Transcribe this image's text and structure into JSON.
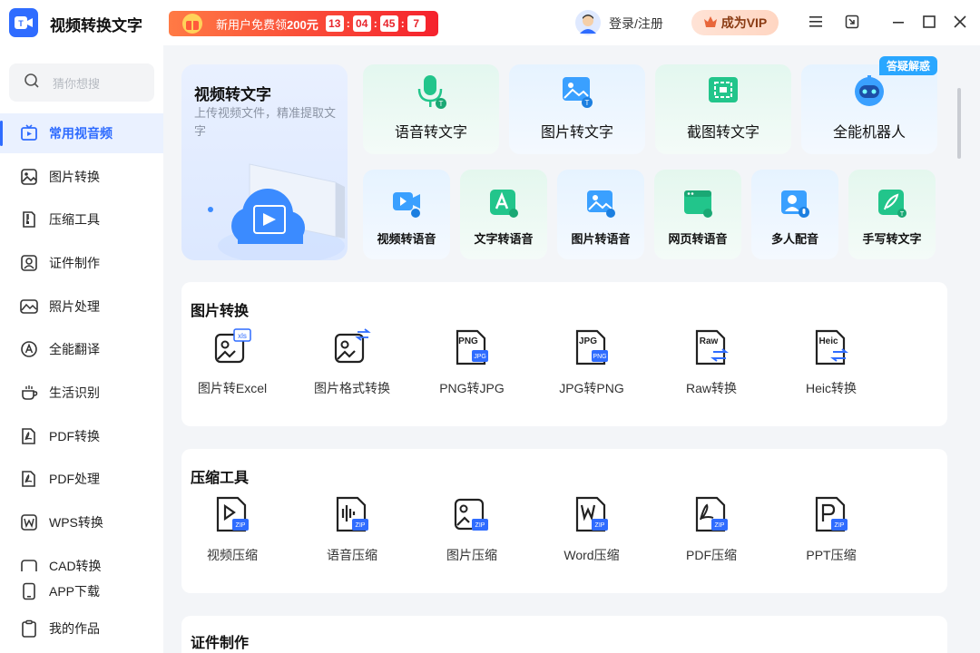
{
  "app": {
    "title": "视频转换文字",
    "logo_text": "T"
  },
  "promo": {
    "text_prefix": "新用户免费领",
    "amount": "200元",
    "countdown": [
      "13",
      "04",
      "45",
      "7"
    ]
  },
  "header": {
    "login": "登录/注册",
    "vip": "成为VIP"
  },
  "search": {
    "placeholder": "猜你想搜"
  },
  "sidebar": {
    "items": [
      {
        "label": "常用视音频",
        "icon": "video-tv-icon",
        "active": true
      },
      {
        "label": "图片转换",
        "icon": "image-icon"
      },
      {
        "label": "压缩工具",
        "icon": "zip-icon"
      },
      {
        "label": "证件制作",
        "icon": "id-photo-icon"
      },
      {
        "label": "照片处理",
        "icon": "photo-icon"
      },
      {
        "label": "全能翻译",
        "icon": "translate-icon"
      },
      {
        "label": "生活识别",
        "icon": "cup-icon"
      },
      {
        "label": "PDF转换",
        "icon": "pdf-convert-icon"
      },
      {
        "label": "PDF处理",
        "icon": "pdf-process-icon"
      },
      {
        "label": "WPS转换",
        "icon": "wps-icon"
      },
      {
        "label": "CAD转换",
        "icon": "cad-icon"
      }
    ],
    "bottom": [
      {
        "label": "APP下载",
        "icon": "phone-icon"
      },
      {
        "label": "我的作品",
        "icon": "clipboard-icon"
      }
    ]
  },
  "hero": {
    "title": "视频转文字",
    "desc": "上传视频文件，精准提取文字"
  },
  "top_tools": [
    {
      "label": "语音转文字",
      "icon": "microphone-icon"
    },
    {
      "label": "图片转文字",
      "icon": "image-text-icon"
    },
    {
      "label": "截图转文字",
      "icon": "screenshot-icon"
    },
    {
      "label": "全能机器人",
      "icon": "robot-icon"
    }
  ],
  "badge": "答疑解惑",
  "small_tools": [
    {
      "label": "视频转语音",
      "icon": "video-audio-icon"
    },
    {
      "label": "文字转语音",
      "icon": "text-audio-icon"
    },
    {
      "label": "图片转语音",
      "icon": "image-audio-icon"
    },
    {
      "label": "网页转语音",
      "icon": "web-audio-icon"
    },
    {
      "label": "多人配音",
      "icon": "multi-voice-icon"
    },
    {
      "label": "手写转文字",
      "icon": "handwriting-icon"
    }
  ],
  "sections": [
    {
      "title": "图片转换",
      "items": [
        {
          "label": "图片转Excel",
          "tag": "xls"
        },
        {
          "label": "图片格式转换",
          "tag": "⇄"
        },
        {
          "label": "PNG转JPG",
          "tag": "PNG"
        },
        {
          "label": "JPG转PNG",
          "tag": "JPG"
        },
        {
          "label": "Raw转换",
          "tag": "Raw"
        },
        {
          "label": "Heic转换",
          "tag": "Heic"
        }
      ]
    },
    {
      "title": "压缩工具",
      "items": [
        {
          "label": "视频压缩",
          "tag": "ZIP"
        },
        {
          "label": "语音压缩",
          "tag": "ZIP"
        },
        {
          "label": "图片压缩",
          "tag": "ZIP"
        },
        {
          "label": "Word压缩",
          "tag": "ZIP"
        },
        {
          "label": "PDF压缩",
          "tag": "ZIP"
        },
        {
          "label": "PPT压缩",
          "tag": "ZIP"
        }
      ]
    },
    {
      "title": "证件制作",
      "items": []
    }
  ],
  "colors": {
    "accent": "#2f6cff",
    "green": "#22c58b",
    "promo": "#f5222d"
  }
}
